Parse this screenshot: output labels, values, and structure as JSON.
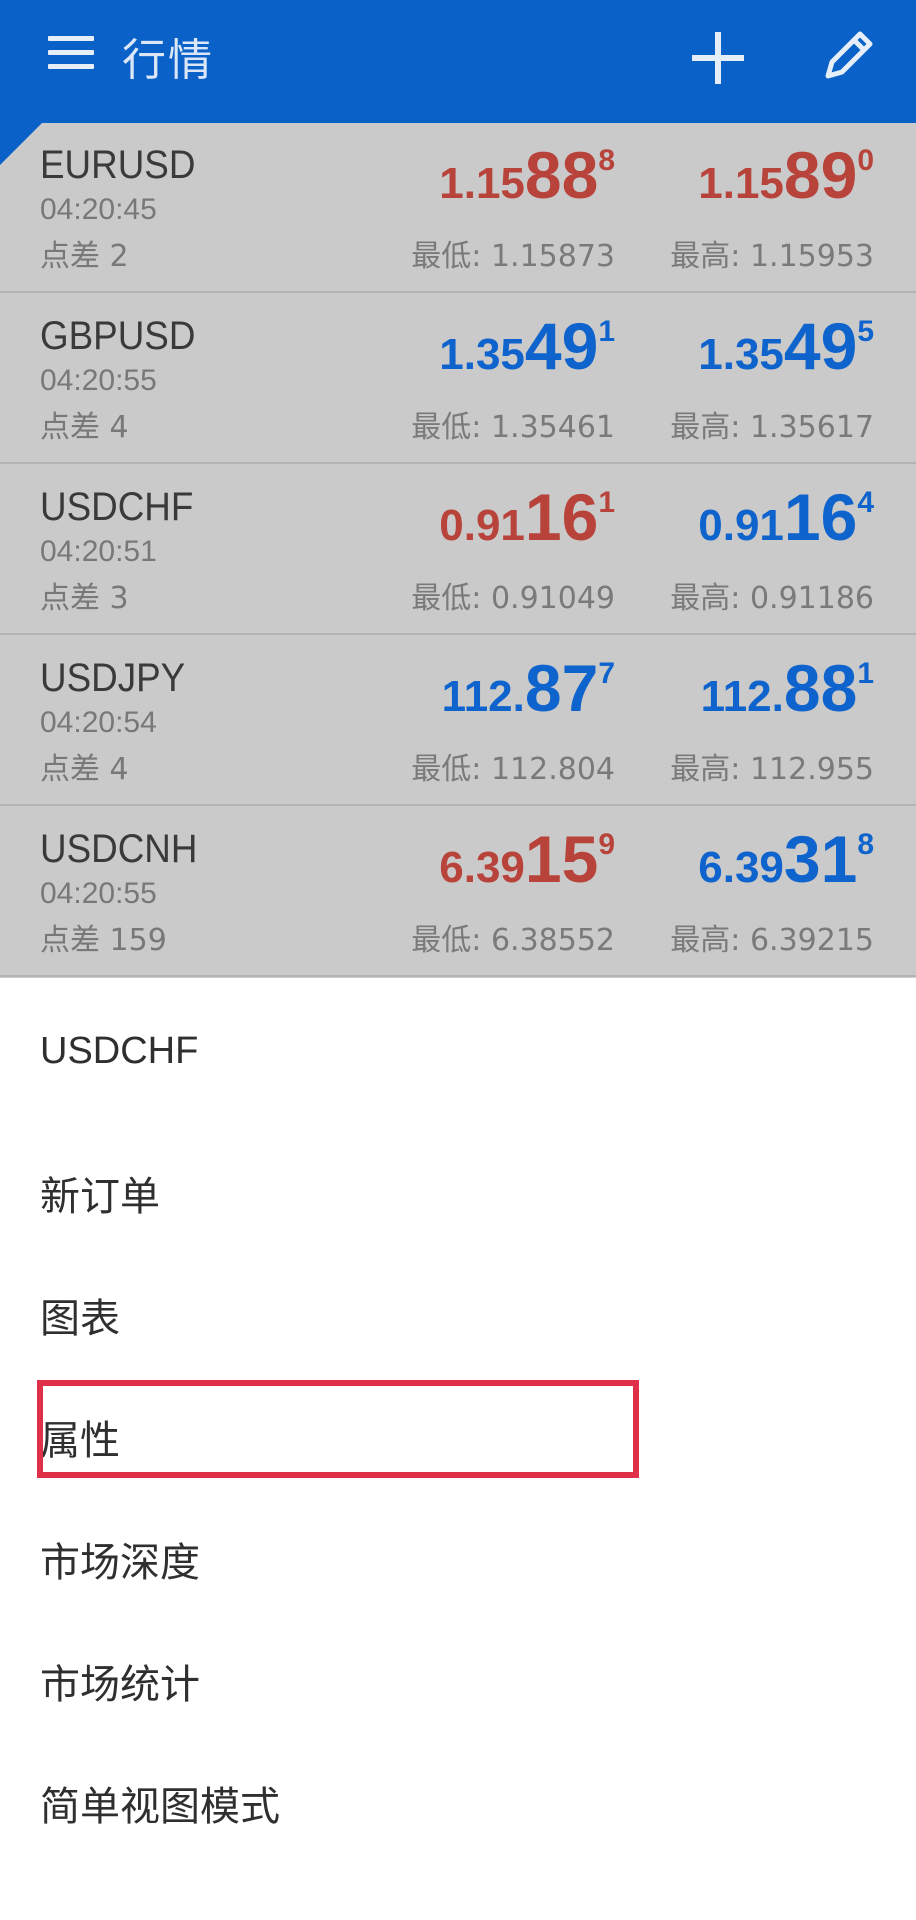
{
  "app_bar": {
    "title": "行情",
    "menu_icon": "hamburger-menu-icon",
    "add_icon": "plus-icon",
    "edit_icon": "pencil-icon",
    "color": "#0a62c9"
  },
  "quotes": [
    {
      "symbol": "EURUSD",
      "time": "04:20:45",
      "spread": "点差 2",
      "bid": {
        "small": "1.15",
        "big": "88",
        "sup": "8",
        "color": "red"
      },
      "ask": {
        "small": "1.15",
        "big": "89",
        "sup": "0",
        "color": "red"
      },
      "low": "最低: 1.15873",
      "high": "最高: 1.15953"
    },
    {
      "symbol": "GBPUSD",
      "time": "04:20:55",
      "spread": "点差 4",
      "bid": {
        "small": "1.35",
        "big": "49",
        "sup": "1",
        "color": "blue"
      },
      "ask": {
        "small": "1.35",
        "big": "49",
        "sup": "5",
        "color": "blue"
      },
      "low": "最低: 1.35461",
      "high": "最高: 1.35617"
    },
    {
      "symbol": "USDCHF",
      "time": "04:20:51",
      "spread": "点差 3",
      "bid": {
        "small": "0.91",
        "big": "16",
        "sup": "1",
        "color": "red"
      },
      "ask": {
        "small": "0.91",
        "big": "16",
        "sup": "4",
        "color": "blue"
      },
      "low": "最低: 0.91049",
      "high": "最高: 0.91186"
    },
    {
      "symbol": "USDJPY",
      "time": "04:20:54",
      "spread": "点差 4",
      "bid": {
        "small": "112.",
        "big": "87",
        "sup": "7",
        "color": "blue"
      },
      "ask": {
        "small": "112.",
        "big": "88",
        "sup": "1",
        "color": "blue"
      },
      "low": "最低: 112.804",
      "high": "最高: 112.955"
    },
    {
      "symbol": "USDCNH",
      "time": "04:20:55",
      "spread": "点差 159",
      "bid": {
        "small": "6.39",
        "big": "15",
        "sup": "9",
        "color": "red"
      },
      "ask": {
        "small": "6.39",
        "big": "31",
        "sup": "8",
        "color": "blue"
      },
      "low": "最低: 6.38552",
      "high": "最高: 6.39215"
    }
  ],
  "context_menu": {
    "header": "USDCHF",
    "items": [
      "新订单",
      "图表",
      "属性",
      "市场深度",
      "市场统计",
      "简单视图模式"
    ],
    "highlighted_item": "属性",
    "highlight_color": "#e03049"
  },
  "colors": {
    "bid_red": "#b8433a",
    "price_blue": "#0f63cc",
    "list_bg": "#cacaca"
  }
}
